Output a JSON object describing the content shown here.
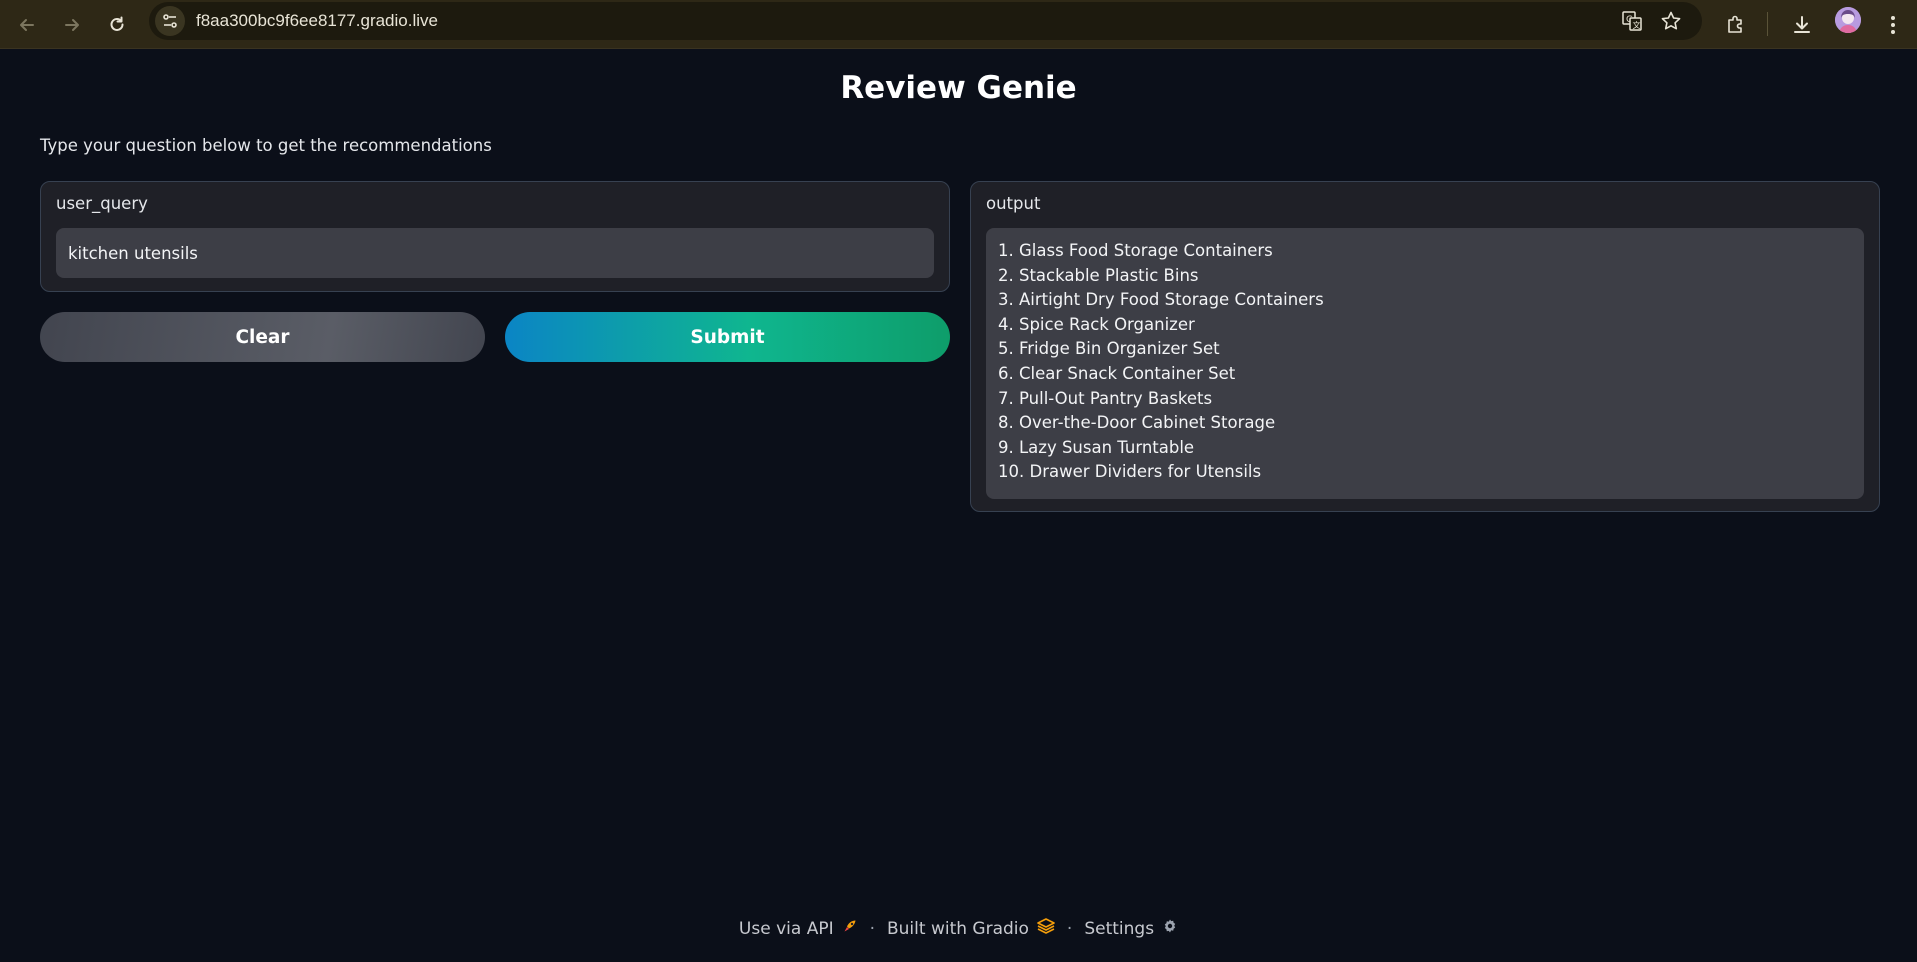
{
  "browser": {
    "url": "f8aa300bc9f6ee8177.gradio.live"
  },
  "app": {
    "title": "Review Genie",
    "description": "Type your question below to get the recommendations",
    "input": {
      "label": "user_query",
      "value": "kitchen utensils"
    },
    "buttons": {
      "clear": "Clear",
      "submit": "Submit"
    },
    "output": {
      "label": "output",
      "items": [
        "1. Glass Food Storage Containers",
        "2. Stackable Plastic Bins",
        "3. Airtight Dry Food Storage Containers",
        "4. Spice Rack Organizer",
        "5. Fridge Bin Organizer Set",
        "6. Clear Snack Container Set",
        "7. Pull-Out Pantry Baskets",
        "8. Over-the-Door Cabinet Storage",
        "9. Lazy Susan Turntable",
        "10. Drawer Dividers for Utensils"
      ]
    },
    "footer": {
      "api": "Use via API",
      "built": "Built with Gradio",
      "settings": "Settings",
      "separator": "·"
    }
  },
  "colors": {
    "background": "#0b0f19",
    "panel": "#1f2027",
    "submit_start": "#0b85c5",
    "submit_end": "#0e9d6a"
  }
}
